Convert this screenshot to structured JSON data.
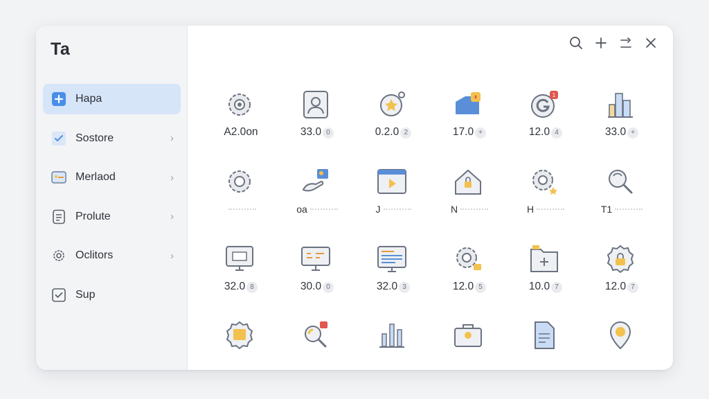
{
  "app": {
    "title": "Ta"
  },
  "sidebar": {
    "items": [
      {
        "label": "Hapa",
        "icon": "plus-square-icon",
        "active": true,
        "chevron": false
      },
      {
        "label": "Sostore",
        "icon": "check-square-icon",
        "active": false,
        "chevron": true
      },
      {
        "label": "Merlaod",
        "icon": "image-card-icon",
        "active": false,
        "chevron": true
      },
      {
        "label": "Prolute",
        "icon": "document-icon",
        "active": false,
        "chevron": true
      },
      {
        "label": "Oclitors",
        "icon": "gear-icon",
        "active": false,
        "chevron": true
      },
      {
        "label": "Sup",
        "icon": "checkbox-icon",
        "active": false,
        "chevron": false
      }
    ]
  },
  "toolbar": {
    "buttons": [
      "search-icon",
      "plus-icon",
      "sort-icon",
      "close-icon"
    ]
  },
  "grid": {
    "rows": [
      [
        {
          "icon": "gear-icon",
          "value": "A2.0",
          "unit": "on"
        },
        {
          "icon": "user-portrait-icon",
          "value": "33.0",
          "unit": "0"
        },
        {
          "icon": "star-badge-icon",
          "value": "0.2.0",
          "unit": "2"
        },
        {
          "icon": "folder-flame-icon",
          "value": "17.0",
          "unit": "+"
        },
        {
          "icon": "g-notification-icon",
          "value": "12.0",
          "unit": "4"
        },
        {
          "icon": "bar-buildings-icon",
          "value": "33.0",
          "unit": "+"
        }
      ],
      [
        {
          "icon": "gear-icon",
          "label": ""
        },
        {
          "icon": "hand-image-icon",
          "label": "oa"
        },
        {
          "icon": "browser-play-icon",
          "label": "J"
        },
        {
          "icon": "home-lock-icon",
          "label": "N"
        },
        {
          "icon": "gear-star-icon",
          "label": "H"
        },
        {
          "icon": "search-refresh-icon",
          "label": "T1"
        }
      ],
      [
        {
          "icon": "monitor-icon",
          "value": "32.0",
          "unit": "8"
        },
        {
          "icon": "monitor-code-icon",
          "value": "30.0",
          "unit": "0"
        },
        {
          "icon": "browser-list-icon",
          "value": "32.0",
          "unit": "3"
        },
        {
          "icon": "gear-folder-icon",
          "value": "12.0",
          "unit": "5"
        },
        {
          "icon": "folder-plus-icon",
          "value": "10.0",
          "unit": "7"
        },
        {
          "icon": "gear-lock-icon",
          "value": "12.0",
          "unit": "7"
        }
      ],
      [
        {
          "icon": "gear-image-icon",
          "value": ""
        },
        {
          "icon": "search-alert-icon",
          "value": ""
        },
        {
          "icon": "bar-chart-icon",
          "value": ""
        },
        {
          "icon": "briefcase-bulb-icon",
          "value": ""
        },
        {
          "icon": "file-icon",
          "value": ""
        },
        {
          "icon": "location-pin-icon",
          "value": ""
        }
      ]
    ]
  },
  "colors": {
    "accent": "#4a8fe7",
    "active_bg": "#d6e5f8",
    "icon_stroke": "#6b7280",
    "highlight_yellow": "#f2c14e",
    "badge_red": "#e0574f"
  }
}
